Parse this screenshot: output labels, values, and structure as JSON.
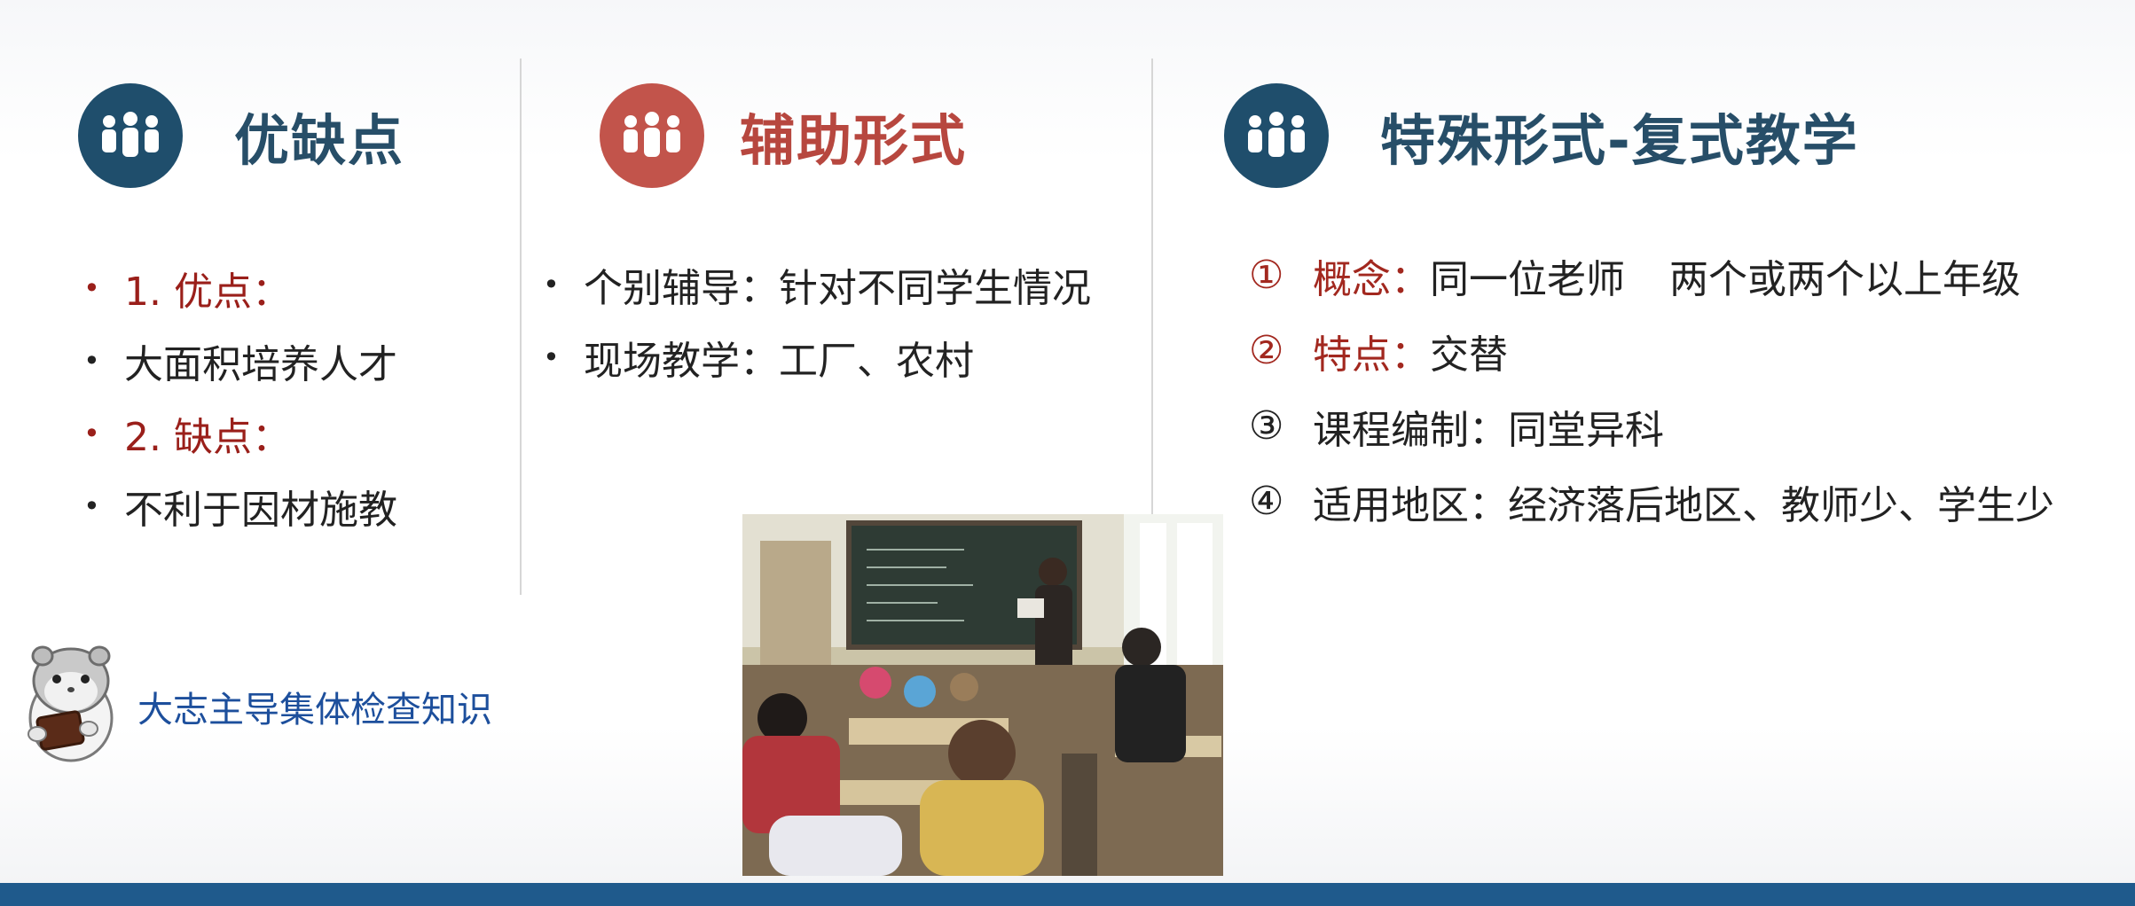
{
  "columns": {
    "advantages": {
      "title": "优缺点",
      "icon": "group-people-icon",
      "items": [
        {
          "text": "1. 优点：",
          "highlight": true
        },
        {
          "text": "大面积培养人才",
          "highlight": false
        },
        {
          "text": "2. 缺点：",
          "highlight": true
        },
        {
          "text": "不利于因材施教",
          "highlight": false
        }
      ]
    },
    "auxiliary": {
      "title": "辅助形式",
      "icon": "group-people-icon",
      "items": [
        {
          "text": "个别辅导：针对不同学生情况"
        },
        {
          "text": "现场教学：工厂、农村"
        }
      ]
    },
    "special": {
      "title": "特殊形式-复式教学",
      "icon": "group-people-icon",
      "items": [
        {
          "num": "①",
          "keyword": "概念：",
          "text_a": "同一位老师",
          "text_b": "两个或两个以上年级",
          "highlight": true
        },
        {
          "num": "②",
          "keyword": "特点：",
          "text_a": "交替",
          "highlight": true
        },
        {
          "num": "③",
          "keyword": "课程编制：",
          "text_a": "同堂异科",
          "highlight": false
        },
        {
          "num": "④",
          "keyword": "适用地区：",
          "text_a": "经济落后地区、教师少、学生少",
          "highlight": false
        }
      ]
    }
  },
  "caption": "大志主导集体检查知识",
  "colors": {
    "header_blue": "#1f4e6c",
    "header_red": "#c2544b",
    "highlight_red": "#9a1f1a",
    "caption_blue": "#1d4f9c",
    "bottom_bar": "#1f5a8c"
  }
}
